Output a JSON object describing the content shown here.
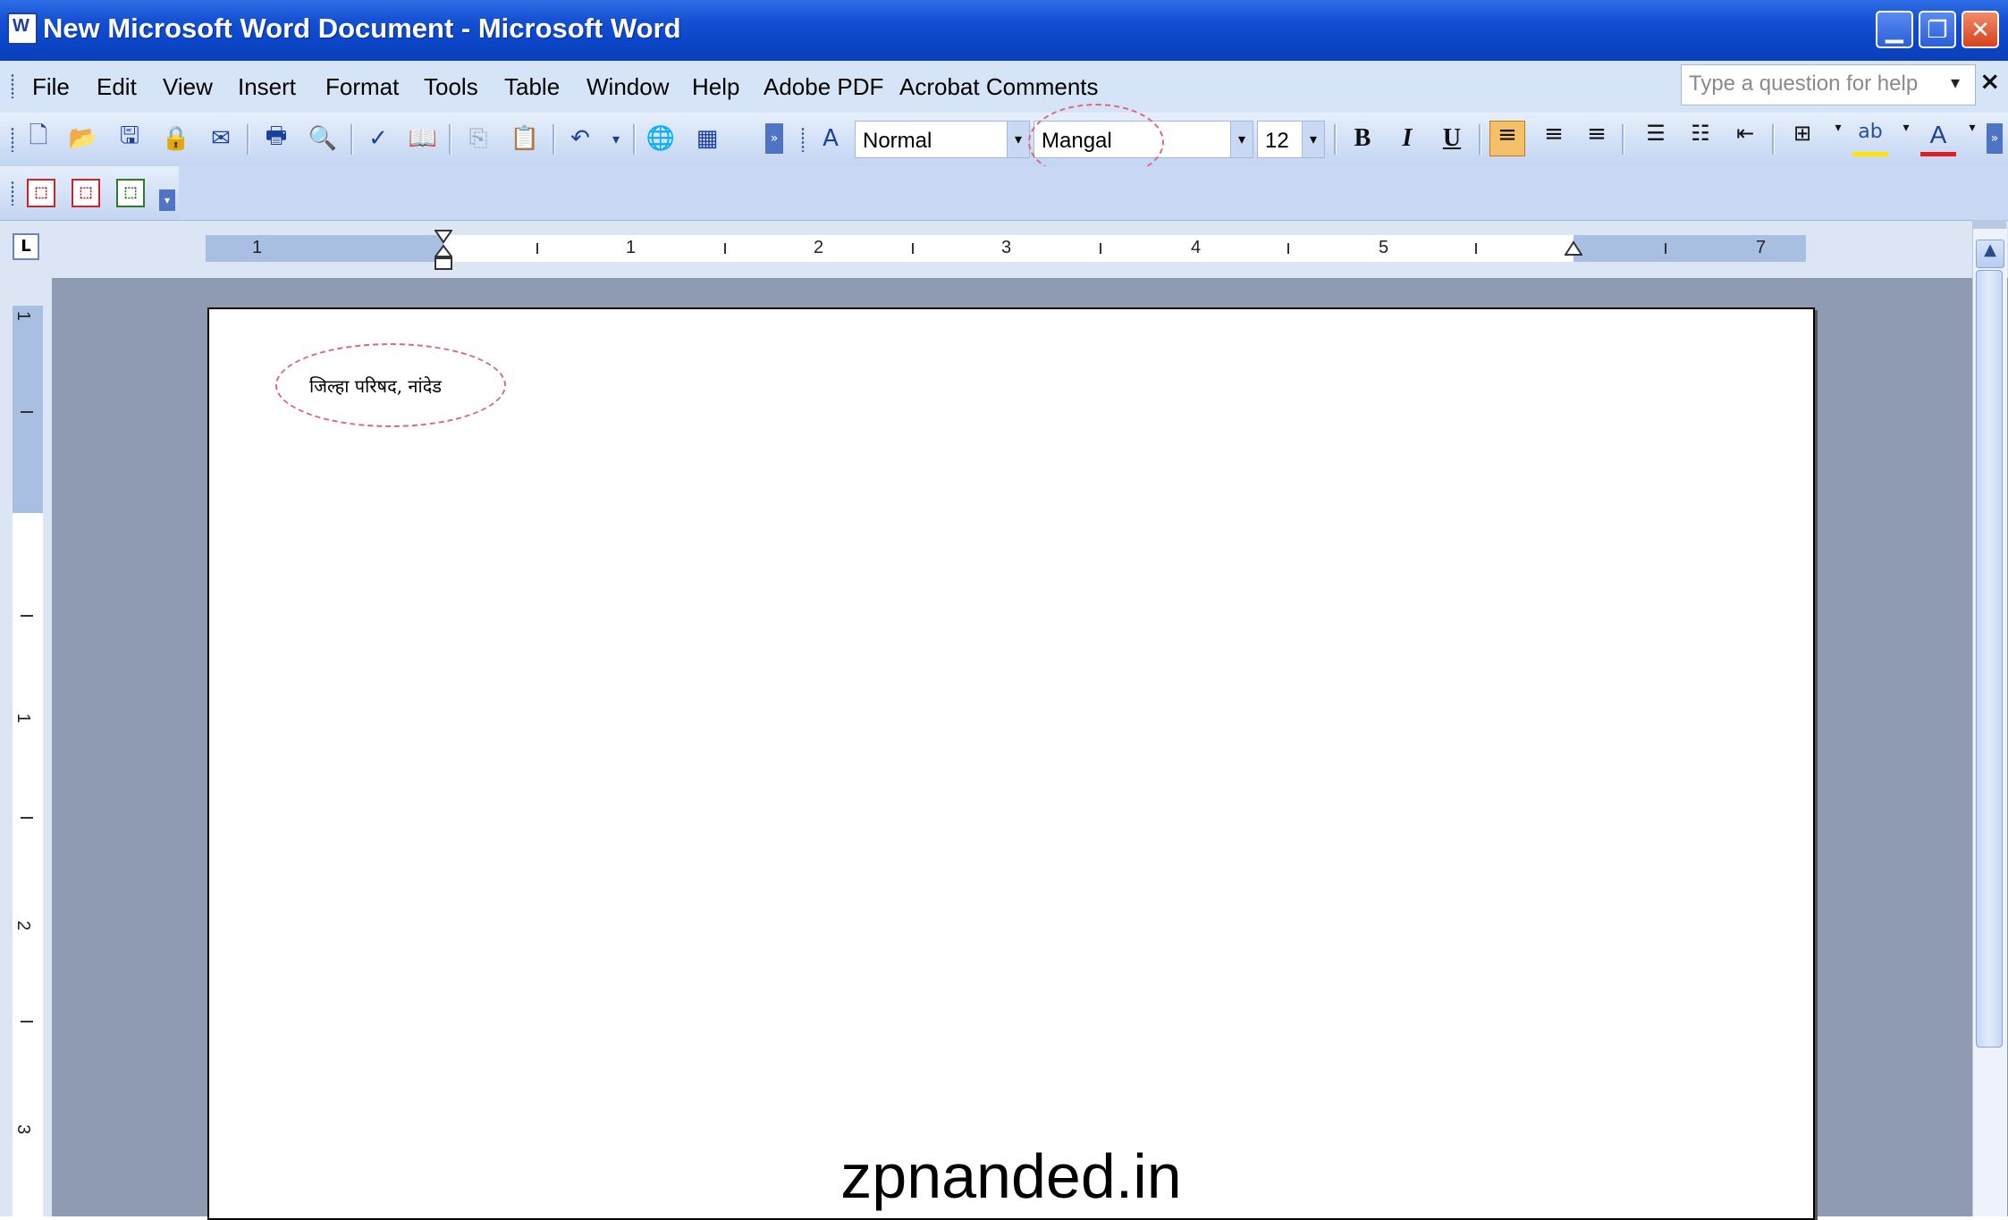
{
  "window": {
    "title": "New Microsoft Word Document - Microsoft Word",
    "buttons": {
      "minimize": "▁",
      "restore": "❐",
      "close": "✕"
    }
  },
  "menu": {
    "items": [
      "File",
      "Edit",
      "View",
      "Insert",
      "Format",
      "Tools",
      "Table",
      "Window",
      "Help",
      "Adobe PDF",
      "Acrobat Comments"
    ],
    "help_placeholder": "Type a question for help",
    "close": "×"
  },
  "format_toolbar": {
    "style": "Normal",
    "font": "Mangal",
    "size": "12",
    "bold": "B",
    "italic": "I",
    "underline": "U",
    "font_color_label": "A"
  },
  "ruler": {
    "tab_selector": "L",
    "numbers": [
      "1",
      "1",
      "2",
      "3",
      "4",
      "5",
      "7"
    ],
    "vertical_numbers": [
      "1",
      "1",
      "2",
      "3"
    ]
  },
  "document": {
    "text": "जिल्हा परिषद, नांदेड"
  },
  "watermark": "zpnanded.in",
  "colors": {
    "title_bar": "#0b45c8",
    "toolbar": "#c3d5f2",
    "workspace": "#8e9bb3",
    "highlight_ellipse": "#d86a7a"
  }
}
